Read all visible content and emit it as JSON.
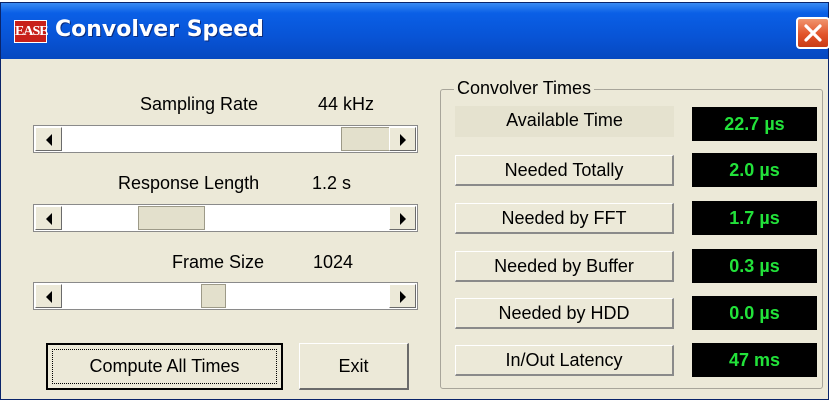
{
  "window": {
    "title": "Convolver Speed",
    "logo_text": "EASE",
    "close_icon": "close-icon"
  },
  "sliders": [
    {
      "label": "Sampling Rate",
      "value": "44 kHz"
    },
    {
      "label": "Response Length",
      "value": "1.2 s"
    },
    {
      "label": "Frame Size",
      "value": "1024"
    }
  ],
  "buttons": {
    "compute": "Compute All Times",
    "exit": "Exit"
  },
  "convolver_times": {
    "title": "Convolver Times",
    "rows": [
      {
        "label": "Available Time",
        "value": "22.7 µs"
      },
      {
        "label": "Needed Totally",
        "value": "2.0 µs"
      },
      {
        "label": "Needed  by FFT",
        "value": "1.7 µs"
      },
      {
        "label": "Needed by Buffer",
        "value": "0.3 µs"
      },
      {
        "label": "Needed by HDD",
        "value": "0.0 µs"
      },
      {
        "label": "In/Out Latency",
        "value": "47 ms"
      }
    ]
  },
  "colors": {
    "title_bar": "#0854d6",
    "readout_bg": "#000000",
    "readout_text": "#22e23a",
    "window_bg": "#ece9d8"
  }
}
